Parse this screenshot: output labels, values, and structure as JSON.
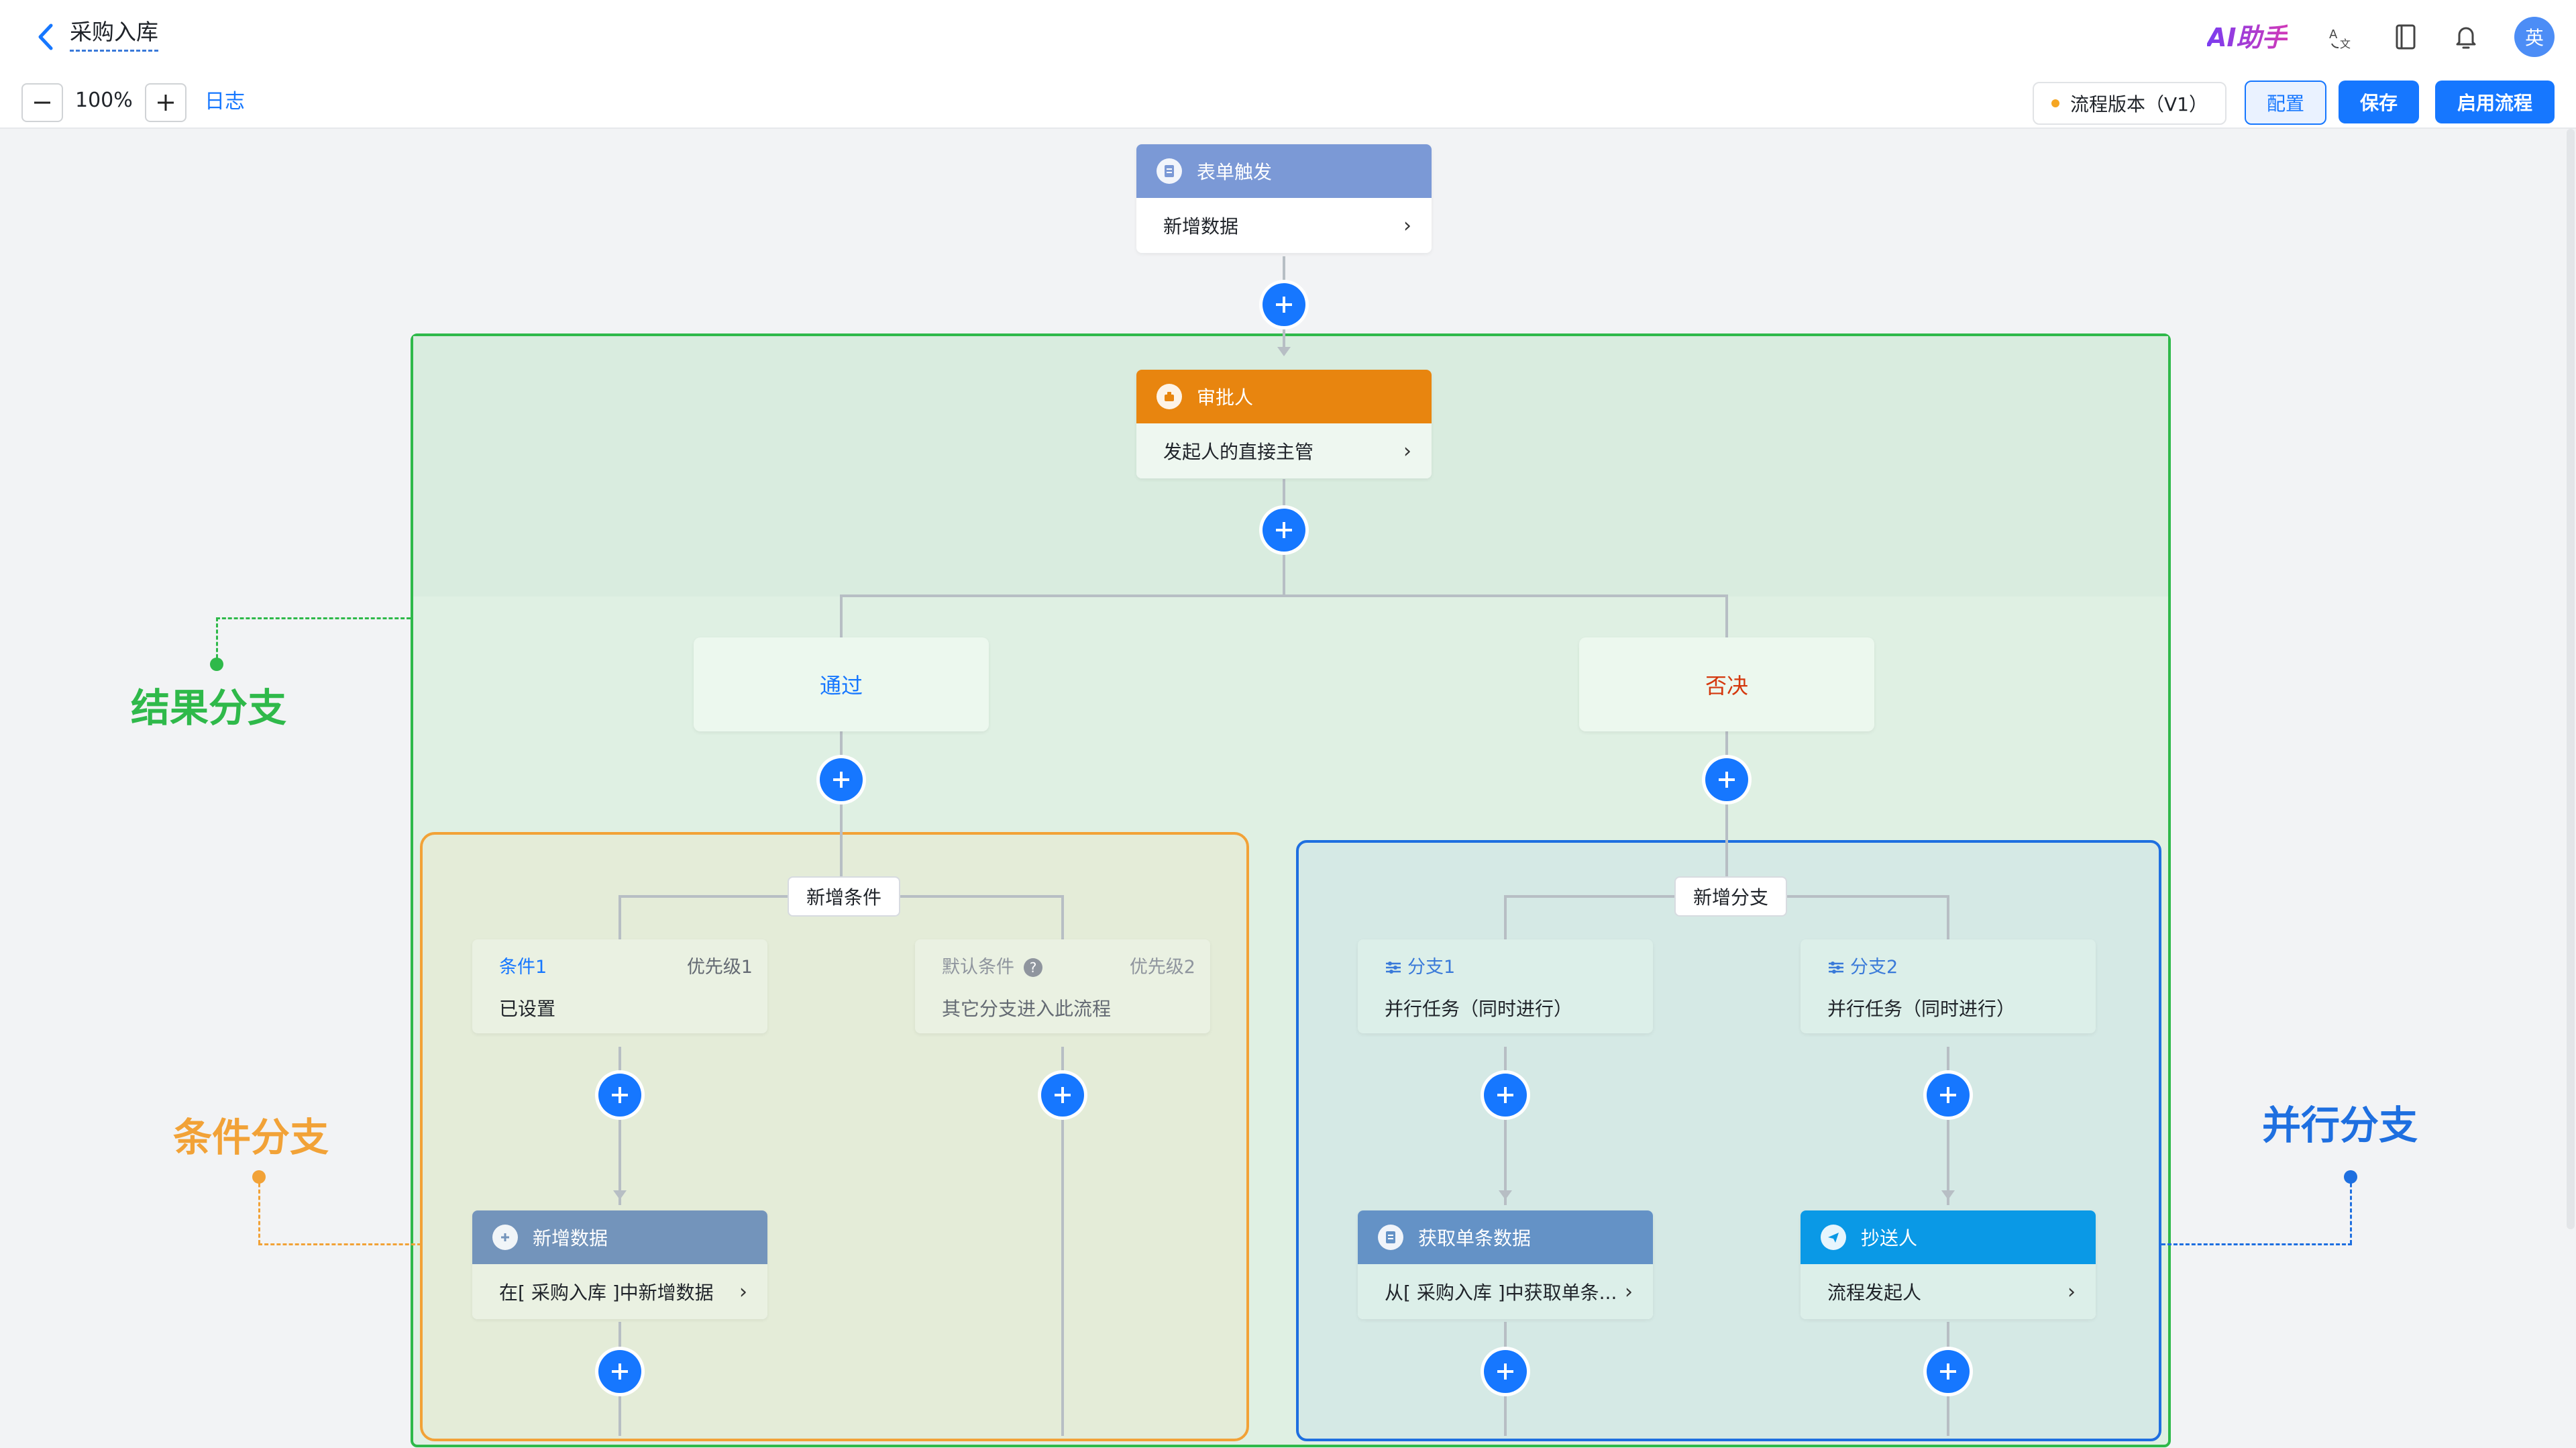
{
  "header": {
    "title": "采购入库",
    "ai_label": "AI助手",
    "avatar_text": "英"
  },
  "toolbar": {
    "zoom": "100%",
    "log_label": "日志",
    "version_label": "流程版本（V1）",
    "config_label": "配置",
    "save_label": "保存",
    "enable_label": "启用流程"
  },
  "colors": {
    "primary": "#1677ff",
    "result_branch": "#2fb94a",
    "condition_branch": "#f2a237",
    "parallel_branch": "#1e6fe0",
    "reject": "#d4380d"
  },
  "flow": {
    "trigger": {
      "title": "表单触发",
      "body": "新增数据",
      "icon": "form-icon"
    },
    "approver": {
      "title": "审批人",
      "body": "发起人的直接主管",
      "icon": "approver-icon"
    },
    "result_branches": {
      "pass": "通过",
      "reject": "否决"
    },
    "condition_group": {
      "add_label": "新增条件",
      "cond1": {
        "name": "条件1",
        "priority": "优先级1",
        "body": "已设置"
      },
      "default": {
        "name": "默认条件",
        "priority": "优先级2",
        "body": "其它分支进入此流程"
      },
      "add_data": {
        "title": "新增数据",
        "body": "在[ 采购入库 ]中新增数据"
      }
    },
    "parallel_group": {
      "add_label": "新增分支",
      "branch1": {
        "name": "分支1",
        "body": "并行任务（同时进行）"
      },
      "branch2": {
        "name": "分支2",
        "body": "并行任务（同时进行）"
      },
      "get_data": {
        "title": "获取单条数据",
        "body": "从[ 采购入库 ]中获取单条..."
      },
      "cc": {
        "title": "抄送人",
        "body": "流程发起人"
      }
    }
  },
  "annotations": {
    "result": "结果分支",
    "condition": "条件分支",
    "parallel": "并行分支"
  }
}
